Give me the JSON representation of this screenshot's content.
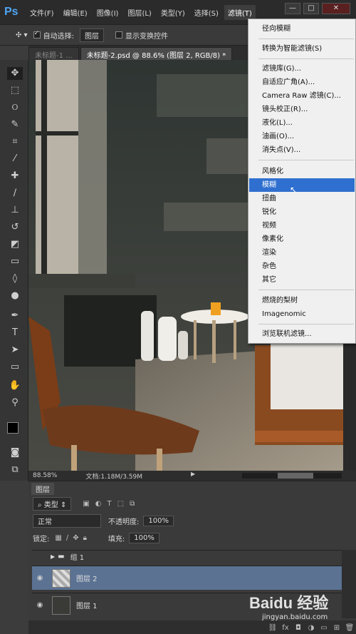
{
  "app": {
    "logo": "Ps"
  },
  "menubar": {
    "items": [
      "文件(F)",
      "编辑(E)",
      "图像(I)",
      "图层(L)",
      "类型(Y)",
      "选择(S)",
      "滤镜(T)"
    ],
    "active": "滤镜(T)"
  },
  "window_controls": {
    "minimize": "—",
    "maximize": "□",
    "close": "✕"
  },
  "options_bar": {
    "auto_select_label": "自动选择:",
    "auto_select_value": "图层",
    "show_transform_label": "显示变换控件"
  },
  "tabs": [
    "未标题-1 ...",
    "未标题-2.psd @ 88.6% (图层 2, RGB/8) *"
  ],
  "status": {
    "zoom": "88.58%",
    "doc_info": "文档:1.18M/3.59M"
  },
  "filter_menu": {
    "items": [
      "径向模糊",
      "转换为智能滤镜(S)",
      "滤镜库(G)...",
      "自适应广角(A)...",
      "Camera Raw 滤镜(C)...",
      "镜头校正(R)...",
      "液化(L)...",
      "油画(O)...",
      "消失点(V)...",
      "风格化",
      "模糊",
      "扭曲",
      "锐化",
      "视频",
      "像素化",
      "渲染",
      "杂色",
      "其它",
      "燃烧的梨树",
      "Imagenomic",
      "浏览联机滤镜..."
    ],
    "highlighted": "模糊"
  },
  "layers_panel": {
    "title": "图层",
    "filter_kind": "类型",
    "blend_mode": "正常",
    "opacity_label": "不透明度:",
    "opacity_value": "100%",
    "lock_label": "锁定:",
    "fill_label": "填充:",
    "fill_value": "100%",
    "layers": [
      {
        "name": "组 1",
        "type": "group",
        "visible": false,
        "selected": false
      },
      {
        "name": "图层 2",
        "type": "layer",
        "visible": true,
        "selected": true
      },
      {
        "name": "图层 1",
        "type": "layer",
        "visible": true,
        "selected": false
      }
    ]
  },
  "watermark": {
    "brand": "Baidu 经验",
    "url": "jingyan.baidu.com"
  },
  "colors": {
    "menu_highlight": "#2f6fcf",
    "selected_layer": "#5b7293",
    "ps_blue": "#4ea6f4"
  }
}
